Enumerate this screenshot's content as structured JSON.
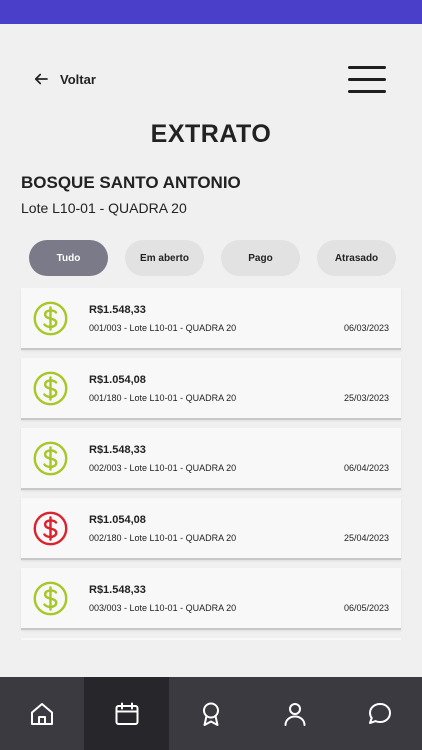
{
  "header": {
    "back_label": "Voltar",
    "back_icon": "arrow-left-icon",
    "menu_icon": "hamburger-menu-icon"
  },
  "page": {
    "title": "EXTRATO",
    "project_name": "BOSQUE SANTO ANTONIO",
    "lot_info": "Lote L10-01 - QUADRA 20"
  },
  "filters": [
    {
      "label": "Tudo",
      "active": true
    },
    {
      "label": "Em aberto",
      "active": false
    },
    {
      "label": "Pago",
      "active": false
    },
    {
      "label": "Atrasado",
      "active": false
    }
  ],
  "status_colors": {
    "paid": "#a6c727",
    "overdue": "#d9242f",
    "accent": "#4a3fc9"
  },
  "transactions": [
    {
      "amount": "R$1.548,33",
      "description": "001/003 - Lote L10-01 - QUADRA 20",
      "date": "06/03/2023",
      "status": "paid",
      "icon": "dollar-circle-icon"
    },
    {
      "amount": "R$1.054,08",
      "description": "001/180 - Lote L10-01 - QUADRA 20",
      "date": "25/03/2023",
      "status": "paid",
      "icon": "dollar-circle-icon"
    },
    {
      "amount": "R$1.548,33",
      "description": "002/003 - Lote L10-01 - QUADRA 20",
      "date": "06/04/2023",
      "status": "paid",
      "icon": "dollar-circle-icon"
    },
    {
      "amount": "R$1.054,08",
      "description": "002/180 - Lote L10-01 - QUADRA 20",
      "date": "25/04/2023",
      "status": "overdue",
      "icon": "dollar-circle-icon"
    },
    {
      "amount": "R$1.548,33",
      "description": "003/003 - Lote L10-01 - QUADRA 20",
      "date": "06/05/2023",
      "status": "paid",
      "icon": "dollar-circle-icon"
    }
  ],
  "bottom_nav": [
    {
      "icon": "home-icon",
      "active": false
    },
    {
      "icon": "calendar-icon",
      "active": true
    },
    {
      "icon": "award-icon",
      "active": false
    },
    {
      "icon": "user-icon",
      "active": false
    },
    {
      "icon": "chat-icon",
      "active": false
    }
  ]
}
